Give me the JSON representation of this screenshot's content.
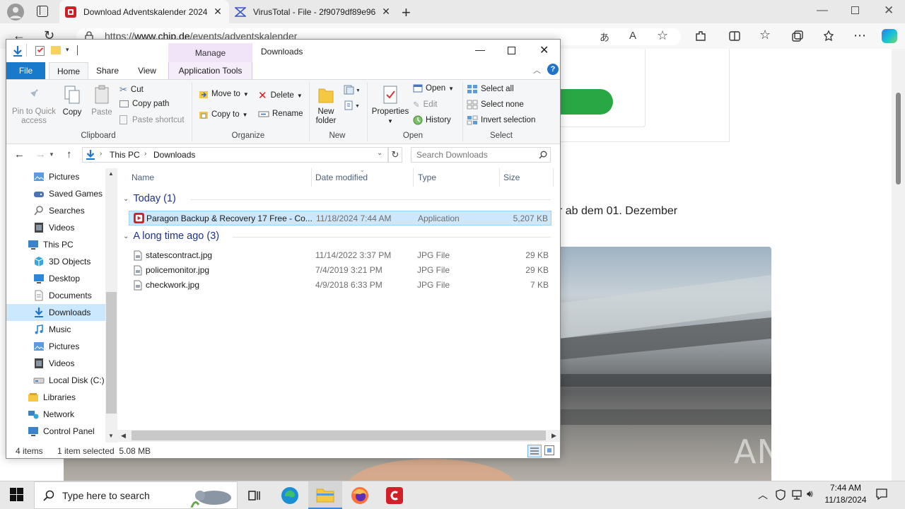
{
  "browser": {
    "tabs": [
      {
        "title": "Download Adventskalender 2024",
        "active": true
      },
      {
        "title": "VirusTotal - File - 2f9079df89e96a",
        "active": false
      }
    ],
    "url_prefix": "https://",
    "url_host": "www.chip.de",
    "url_path": "/events/adventskalender"
  },
  "webpage": {
    "visible_text": "r ab dem 01. Dezember",
    "watermark": "ANY RUN"
  },
  "explorer": {
    "context_tab": "Manage",
    "window_title": "Downloads",
    "ribbon_tabs": [
      "File",
      "Home",
      "Share",
      "View"
    ],
    "context_subtab": "Application Tools",
    "clipboard": {
      "pin_label_1": "Pin to Quick",
      "pin_label_2": "access",
      "copy": "Copy",
      "paste": "Paste",
      "cut": "Cut",
      "copy_path": "Copy path",
      "paste_shortcut": "Paste shortcut",
      "group": "Clipboard"
    },
    "organize": {
      "move_to": "Move to",
      "copy_to": "Copy to",
      "delete": "Delete",
      "rename": "Rename",
      "group": "Organize"
    },
    "new": {
      "new_folder_1": "New",
      "new_folder_2": "folder",
      "group": "New"
    },
    "open": {
      "properties": "Properties",
      "open": "Open",
      "edit": "Edit",
      "history": "History",
      "group": "Open"
    },
    "select": {
      "select_all": "Select all",
      "select_none": "Select none",
      "invert": "Invert selection",
      "group": "Select"
    },
    "breadcrumb": [
      "This PC",
      "Downloads"
    ],
    "search_placeholder": "Search Downloads",
    "nav_items": [
      {
        "label": "Pictures",
        "icon": "pictures-icon",
        "indent": 2,
        "selected": false
      },
      {
        "label": "Saved Games",
        "icon": "saved-games-icon",
        "indent": 2,
        "selected": false
      },
      {
        "label": "Searches",
        "icon": "search-icon",
        "indent": 2,
        "selected": false
      },
      {
        "label": "Videos",
        "icon": "videos-icon",
        "indent": 2,
        "selected": false
      },
      {
        "label": "This PC",
        "icon": "computer-icon",
        "indent": 1,
        "selected": false
      },
      {
        "label": "3D Objects",
        "icon": "3d-objects-icon",
        "indent": 2,
        "selected": false
      },
      {
        "label": "Desktop",
        "icon": "desktop-icon",
        "indent": 2,
        "selected": false
      },
      {
        "label": "Documents",
        "icon": "documents-icon",
        "indent": 2,
        "selected": false
      },
      {
        "label": "Downloads",
        "icon": "downloads-icon",
        "indent": 2,
        "selected": true
      },
      {
        "label": "Music",
        "icon": "music-icon",
        "indent": 2,
        "selected": false
      },
      {
        "label": "Pictures",
        "icon": "pictures-icon",
        "indent": 2,
        "selected": false
      },
      {
        "label": "Videos",
        "icon": "videos-icon",
        "indent": 2,
        "selected": false
      },
      {
        "label": "Local Disk (C:)",
        "icon": "drive-icon",
        "indent": 2,
        "selected": false
      },
      {
        "label": "Libraries",
        "icon": "libraries-icon",
        "indent": 1,
        "selected": false
      },
      {
        "label": "Network",
        "icon": "network-icon",
        "indent": 1,
        "selected": false
      },
      {
        "label": "Control Panel",
        "icon": "control-panel-icon",
        "indent": 1,
        "selected": false
      }
    ],
    "columns": [
      "Name",
      "Date modified",
      "Type",
      "Size"
    ],
    "groups": [
      {
        "label": "Today (1)",
        "files": [
          {
            "name": "Paragon Backup & Recovery 17 Free - Co...",
            "date": "11/18/2024 7:44 AM",
            "type": "Application",
            "size": "5,207 KB",
            "selected": true,
            "icon": "application-icon"
          }
        ]
      },
      {
        "label": "A long time ago (3)",
        "files": [
          {
            "name": "statescontract.jpg",
            "date": "11/14/2022 3:37 PM",
            "type": "JPG File",
            "size": "29 KB",
            "selected": false,
            "icon": "image-file-icon"
          },
          {
            "name": "policemonitor.jpg",
            "date": "7/4/2019 3:21 PM",
            "type": "JPG File",
            "size": "29 KB",
            "selected": false,
            "icon": "image-file-icon"
          },
          {
            "name": "checkwork.jpg",
            "date": "4/9/2018 6:33 PM",
            "type": "JPG File",
            "size": "7 KB",
            "selected": false,
            "icon": "image-file-icon"
          }
        ]
      }
    ],
    "status": {
      "count": "4 items",
      "selection": "1 item selected  5.08 MB"
    }
  },
  "taskbar": {
    "search_placeholder": "Type here to search",
    "time": "7:44 AM",
    "date": "11/18/2024"
  }
}
